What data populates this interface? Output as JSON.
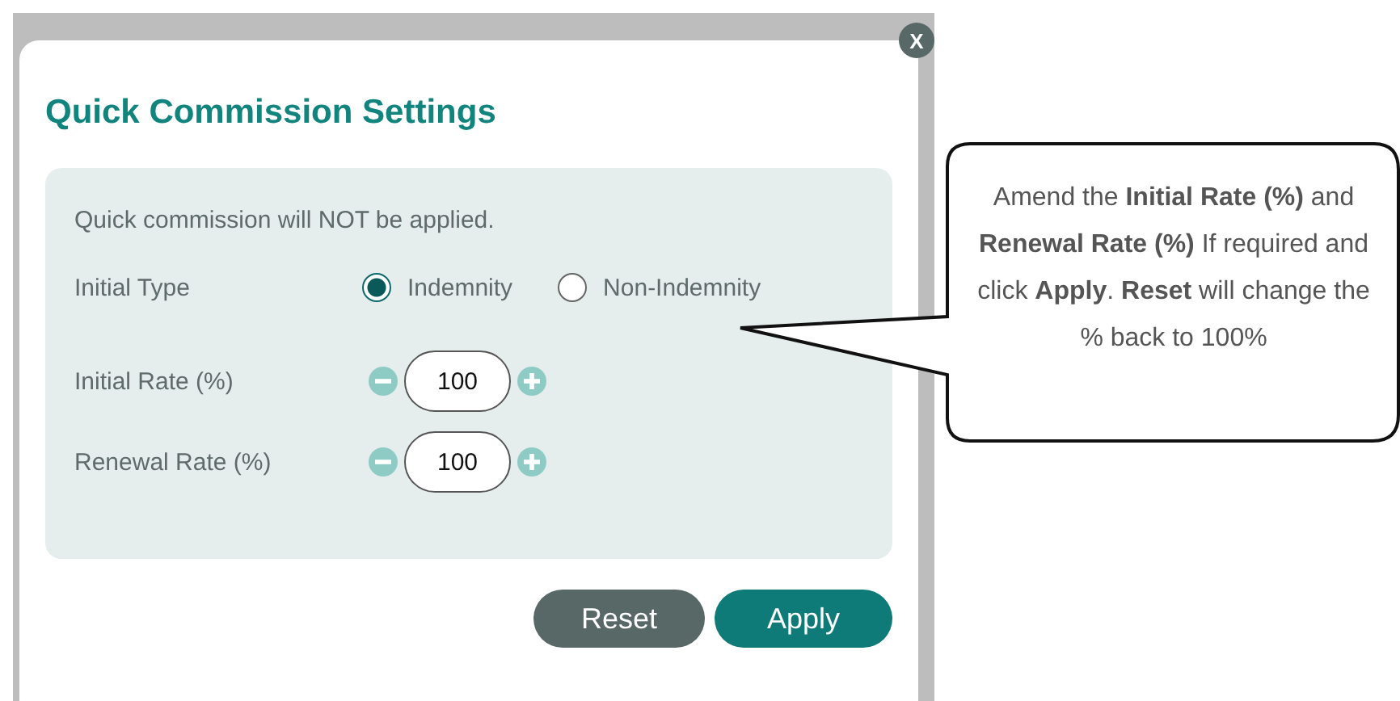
{
  "dialog": {
    "title": "Quick Commission Settings",
    "close_label": "X",
    "message": "Quick commission will NOT be applied.",
    "initial_type": {
      "label": "Initial Type",
      "options": [
        {
          "label": "Indemnity",
          "selected": true
        },
        {
          "label": "Non-Indemnity",
          "selected": false
        }
      ]
    },
    "rates": [
      {
        "label": "Initial Rate (%)",
        "value": "100"
      },
      {
        "label": "Renewal Rate (%)",
        "value": "100"
      }
    ],
    "buttons": [
      {
        "label": "Reset",
        "kind": "secondary"
      },
      {
        "label": "Apply",
        "kind": "primary"
      }
    ]
  },
  "callout": {
    "text": "Amend the **Initial Rate (%)** and **Renewal Rate (%)** If required and click **Apply**. **Reset** will change the % back to 100%"
  }
}
